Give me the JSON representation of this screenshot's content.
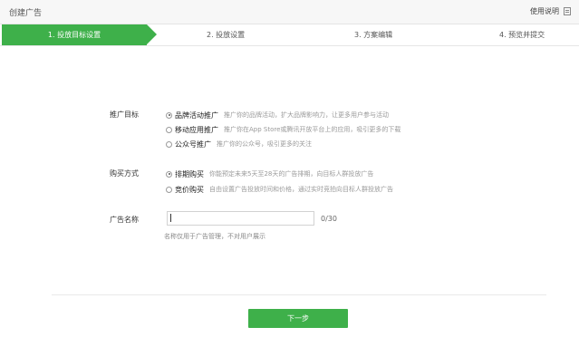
{
  "header": {
    "title": "创建广告",
    "help_label": "使用说明",
    "help_icon": "document-icon"
  },
  "steps": [
    {
      "label": "1. 投放目标设置",
      "active": true
    },
    {
      "label": "2. 投放设置",
      "active": false
    },
    {
      "label": "3. 方案编辑",
      "active": false
    },
    {
      "label": "4. 预览并提交",
      "active": false
    }
  ],
  "form": {
    "target": {
      "label": "推广目标",
      "options": [
        {
          "label": "品牌活动推广",
          "desc": "推广你的品牌活动，扩大品牌影响力，让更多用户参与活动",
          "checked": true
        },
        {
          "label": "移动应用推广",
          "desc": "推广你在App Store或腾讯开放平台上的应用，吸引更多的下载",
          "checked": false
        },
        {
          "label": "公众号推广",
          "desc": "推广你的公众号，吸引更多的关注",
          "checked": false
        }
      ]
    },
    "buy_mode": {
      "label": "购买方式",
      "options": [
        {
          "label": "排期购买",
          "desc": "你能预定未来5天至28天的广告排期，向目标人群投放广告",
          "checked": true
        },
        {
          "label": "竞价购买",
          "desc": "自由设置广告投放时间和价格，通过实时竞拍向目标人群投放广告",
          "checked": false
        }
      ]
    },
    "ad_name": {
      "label": "广告名称",
      "value": "",
      "counter": "0/30",
      "hint": "名称仅用于广告管理，不对用户展示"
    }
  },
  "footer": {
    "next_label": "下一步"
  },
  "colors": {
    "accent": "#3eb04a"
  }
}
